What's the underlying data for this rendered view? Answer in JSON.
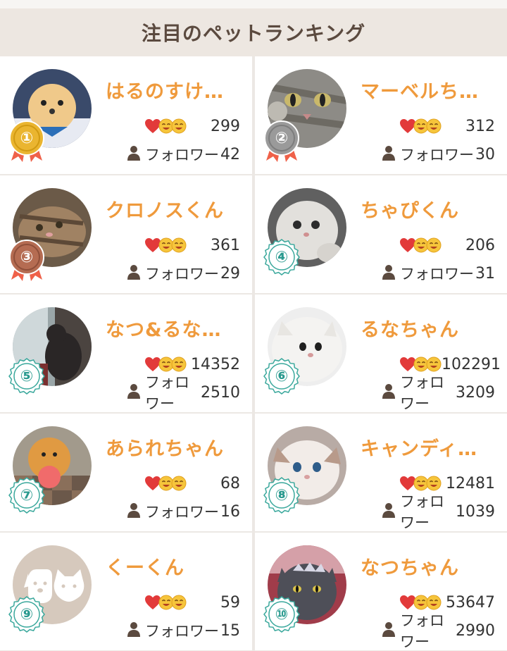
{
  "header": {
    "title": "注目のペットランキング"
  },
  "follow_label": "フォロワー",
  "colors": {
    "name": "#ef9a3c",
    "header_bg": "#ede7e1",
    "teal_badge": "#2a9a8f",
    "heart": "#e23a3a",
    "emoji": "#f6c53b"
  },
  "ranking": [
    {
      "rank": "①",
      "name": "はるのすけ…",
      "likes": "299",
      "followers": "42",
      "avatar_icon": "pomeranian-photo",
      "badge": "gold"
    },
    {
      "rank": "②",
      "name": "マーベルち…",
      "likes": "312",
      "followers": "30",
      "avatar_icon": "tabby-cat-photo",
      "badge": "silver"
    },
    {
      "rank": "③",
      "name": "クロノスくん",
      "likes": "361",
      "followers": "29",
      "avatar_icon": "tabby-cat-lying-photo",
      "badge": "bronze"
    },
    {
      "rank": "④",
      "name": "ちゃぴくん",
      "likes": "206",
      "followers": "31",
      "avatar_icon": "persian-kitten-photo",
      "badge": "teal"
    },
    {
      "rank": "⑤",
      "name": "なつ&るな…",
      "likes": "14352",
      "followers": "2510",
      "avatar_icon": "black-cat-window-photo",
      "badge": "teal"
    },
    {
      "rank": "⑥",
      "name": "るなちゃん",
      "likes": "102291",
      "followers": "3209",
      "avatar_icon": "white-persian-photo",
      "badge": "teal"
    },
    {
      "rank": "⑦",
      "name": "あられちゃん",
      "likes": "68",
      "followers": "16",
      "avatar_icon": "pomeranian-ball-photo",
      "badge": "teal"
    },
    {
      "rank": "⑧",
      "name": "キャンディ…",
      "likes": "12481",
      "followers": "1039",
      "avatar_icon": "ragdoll-kitten-photo",
      "badge": "teal"
    },
    {
      "rank": "⑨",
      "name": "くーくん",
      "likes": "59",
      "followers": "15",
      "avatar_icon": "default-pet-icon",
      "badge": "teal"
    },
    {
      "rank": "⑩",
      "name": "なつちゃん",
      "likes": "53647",
      "followers": "2990",
      "avatar_icon": "gray-cat-tiara-photo",
      "badge": "teal"
    }
  ]
}
